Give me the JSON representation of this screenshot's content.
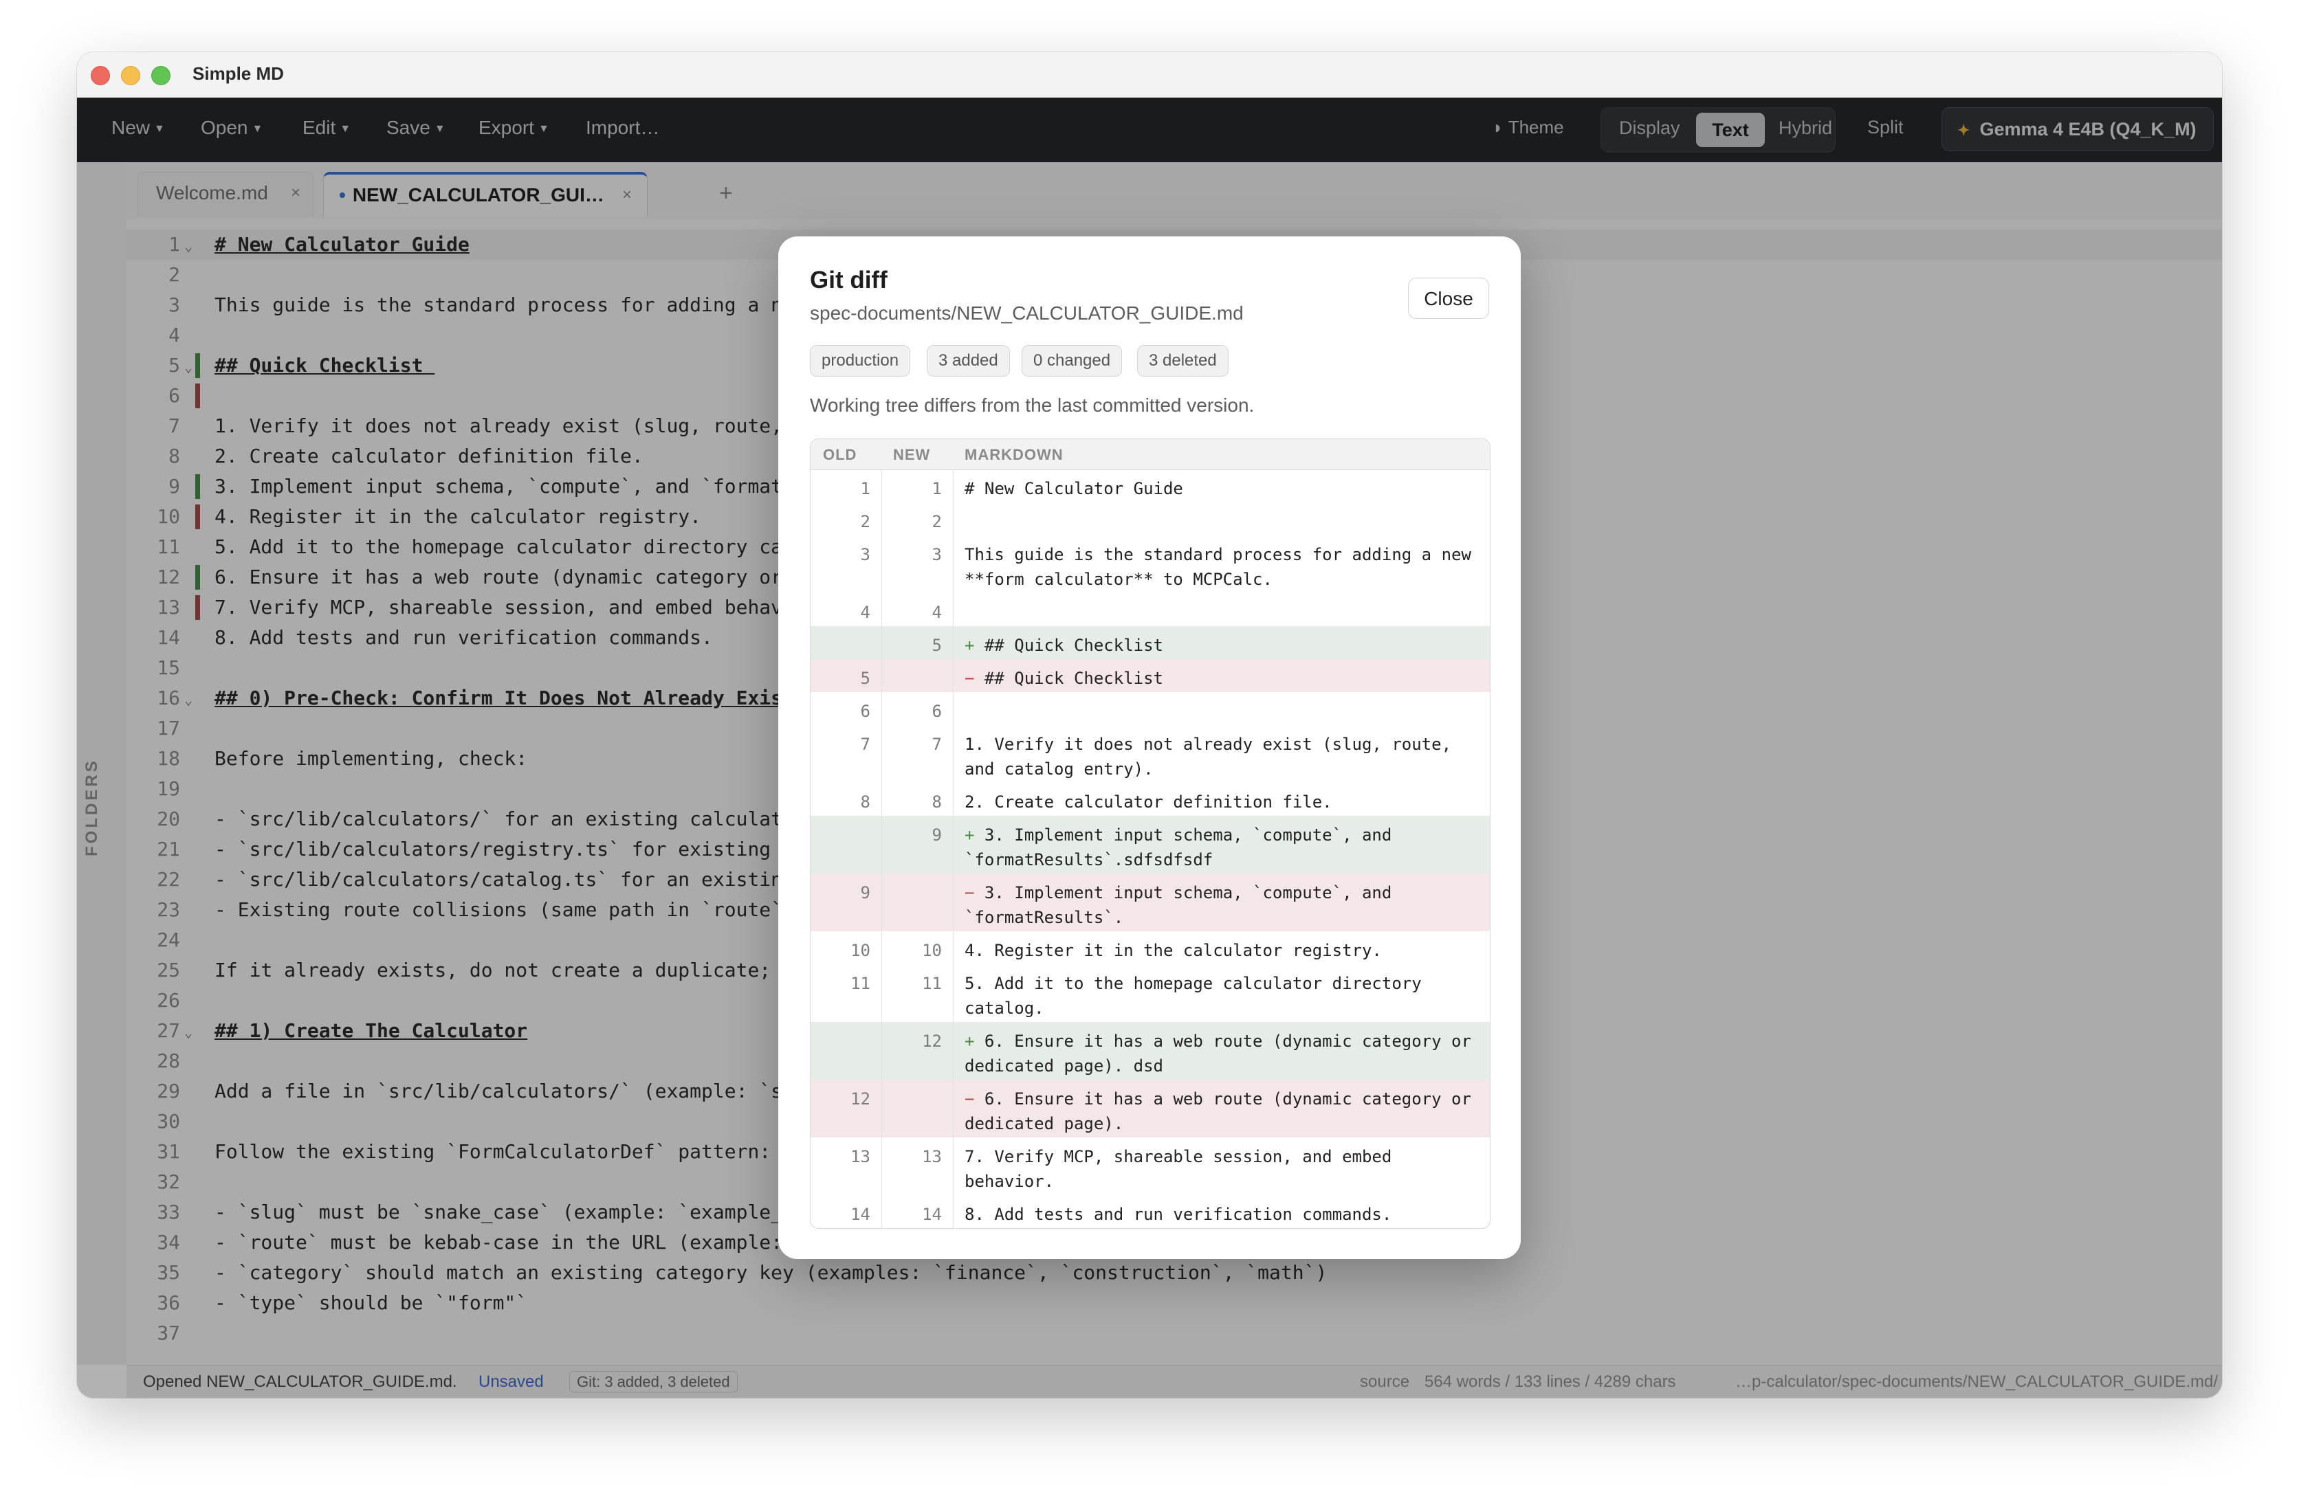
{
  "app": {
    "title": "Simple MD"
  },
  "toolbar": {
    "menus": [
      "New",
      "Open",
      "Edit",
      "Save",
      "Export"
    ],
    "import_label": "Import…",
    "theme_label": "Theme",
    "view_modes": [
      "Display",
      "Text",
      "Hybrid",
      "Split"
    ],
    "active_view_mode": "Text",
    "model_label": "Gemma 4 E4B (Q4_K_M)"
  },
  "tabs": [
    {
      "label": "Welcome.md",
      "active": false,
      "close": "×"
    },
    {
      "label": "NEW_CALCULATOR_GUI…",
      "active": true,
      "close": "×"
    }
  ],
  "tab_add": "+",
  "sidebar": {
    "label": "FOLDERS"
  },
  "editor": {
    "lines": [
      {
        "n": "1",
        "text": "# New Calculator Guide",
        "heading": true,
        "fold": true
      },
      {
        "n": "2",
        "text": ""
      },
      {
        "n": "3",
        "text": "This guide is the standard process for adding a ne"
      },
      {
        "n": "4",
        "text": ""
      },
      {
        "n": "5",
        "text": "## Quick Checklist ",
        "heading": true,
        "fold": true,
        "mark": "add"
      },
      {
        "n": "6",
        "text": "",
        "mark": "del"
      },
      {
        "n": "7",
        "text": "1. Verify it does not already exist (slug, route,"
      },
      {
        "n": "8",
        "text": "2. Create calculator definition file."
      },
      {
        "n": "9",
        "text": "3. Implement input schema, `compute`, and `formatR",
        "mark": "add"
      },
      {
        "n": "10",
        "text": "4. Register it in the calculator registry.",
        "mark": "del"
      },
      {
        "n": "11",
        "text": "5. Add it to the homepage calculator directory cat"
      },
      {
        "n": "12",
        "text": "6. Ensure it has a web route (dynamic category or",
        "mark": "add"
      },
      {
        "n": "13",
        "text": "7. Verify MCP, shareable session, and embed behav",
        "mark": "del"
      },
      {
        "n": "14",
        "text": "8. Add tests and run verification commands."
      },
      {
        "n": "15",
        "text": ""
      },
      {
        "n": "16",
        "text": "## 0) Pre-Check: Confirm It Does Not Already Exis",
        "heading": true,
        "fold": true
      },
      {
        "n": "17",
        "text": ""
      },
      {
        "n": "18",
        "text": "Before implementing, check:"
      },
      {
        "n": "19",
        "text": ""
      },
      {
        "n": "20",
        "text": "- `src/lib/calculators/` for an existing calculato"
      },
      {
        "n": "21",
        "text": "- `src/lib/calculators/registry.ts` for existing"
      },
      {
        "n": "22",
        "text": "- `src/lib/calculators/catalog.ts` for an existin"
      },
      {
        "n": "23",
        "text": "- Existing route collisions (same path in `route`"
      },
      {
        "n": "24",
        "text": ""
      },
      {
        "n": "25",
        "text": "If it already exists, do not create a duplicate; u"
      },
      {
        "n": "26",
        "text": ""
      },
      {
        "n": "27",
        "text": "## 1) Create The Calculator",
        "heading": true,
        "fold": true
      },
      {
        "n": "28",
        "text": ""
      },
      {
        "n": "29",
        "text": "Add a file in `src/lib/calculators/` (example: `s"
      },
      {
        "n": "30",
        "text": ""
      },
      {
        "n": "31",
        "text": "Follow the existing `FormCalculatorDef` pattern:"
      },
      {
        "n": "32",
        "text": ""
      },
      {
        "n": "33",
        "text": "- `slug` must be `snake_case` (example: `example_c"
      },
      {
        "n": "34",
        "text": "- `route` must be kebab-case in the URL (example: `/finance/example-calculator`)"
      },
      {
        "n": "35",
        "text": "- `category` should match an existing category key (examples: `finance`, `construction`, `math`)"
      },
      {
        "n": "36",
        "text": "- `type` should be `\"form\"`"
      },
      {
        "n": "37",
        "text": ""
      }
    ]
  },
  "status": {
    "message": "Opened NEW_CALCULATOR_GUIDE.md.",
    "unsaved": "Unsaved",
    "git": "Git: 3 added, 3 deleted",
    "mode": "source",
    "counts": "564 words / 133 lines / 4289 chars",
    "path": "…p-calculator/spec-documents/NEW_CALCULATOR_GUIDE.md/"
  },
  "modal": {
    "title": "Git diff",
    "path": "spec-documents/NEW_CALCULATOR_GUIDE.md",
    "close_label": "Close",
    "pills": [
      "production",
      "3 added",
      "0 changed",
      "3 deleted"
    ],
    "message": "Working tree differs from the last committed version.",
    "columns": {
      "old": "OLD",
      "new": "NEW",
      "markdown": "MARKDOWN"
    },
    "rows": [
      {
        "old": "1",
        "new": "1",
        "kind": "same",
        "prefix": "",
        "text": "# New Calculator Guide"
      },
      {
        "old": "2",
        "new": "2",
        "kind": "same",
        "prefix": "",
        "text": ""
      },
      {
        "old": "3",
        "new": "3",
        "kind": "same",
        "prefix": "",
        "text": "This guide is the standard process for adding a new\n**form calculator** to MCPCalc."
      },
      {
        "old": "4",
        "new": "4",
        "kind": "same",
        "prefix": "",
        "text": ""
      },
      {
        "old": "",
        "new": "5",
        "kind": "add",
        "prefix": "+ ",
        "text": "## Quick Checklist"
      },
      {
        "old": "5",
        "new": "",
        "kind": "del",
        "prefix": "− ",
        "text": "## Quick Checklist"
      },
      {
        "old": "6",
        "new": "6",
        "kind": "same",
        "prefix": "",
        "text": ""
      },
      {
        "old": "7",
        "new": "7",
        "kind": "same",
        "prefix": "",
        "text": "1. Verify it does not already exist (slug, route,\nand catalog entry)."
      },
      {
        "old": "8",
        "new": "8",
        "kind": "same",
        "prefix": "",
        "text": "2. Create calculator definition file."
      },
      {
        "old": "",
        "new": "9",
        "kind": "add",
        "prefix": "+ ",
        "text": "3. Implement input schema, `compute`, and\n`formatResults`.sdfsdfsdf"
      },
      {
        "old": "9",
        "new": "",
        "kind": "del",
        "prefix": "− ",
        "text": "3. Implement input schema, `compute`, and\n`formatResults`."
      },
      {
        "old": "10",
        "new": "10",
        "kind": "same",
        "prefix": "",
        "text": "4. Register it in the calculator registry."
      },
      {
        "old": "11",
        "new": "11",
        "kind": "same",
        "prefix": "",
        "text": "5. Add it to the homepage calculator directory\ncatalog."
      },
      {
        "old": "",
        "new": "12",
        "kind": "add",
        "prefix": "+ ",
        "text": "6. Ensure it has a web route (dynamic category or\ndedicated page). dsd"
      },
      {
        "old": "12",
        "new": "",
        "kind": "del",
        "prefix": "− ",
        "text": "6. Ensure it has a web route (dynamic category or\ndedicated page)."
      },
      {
        "old": "13",
        "new": "13",
        "kind": "same",
        "prefix": "",
        "text": "7. Verify MCP, shareable session, and embed\nbehavior."
      },
      {
        "old": "14",
        "new": "14",
        "kind": "same",
        "prefix": "",
        "text": "8. Add tests and run verification commands."
      }
    ]
  }
}
